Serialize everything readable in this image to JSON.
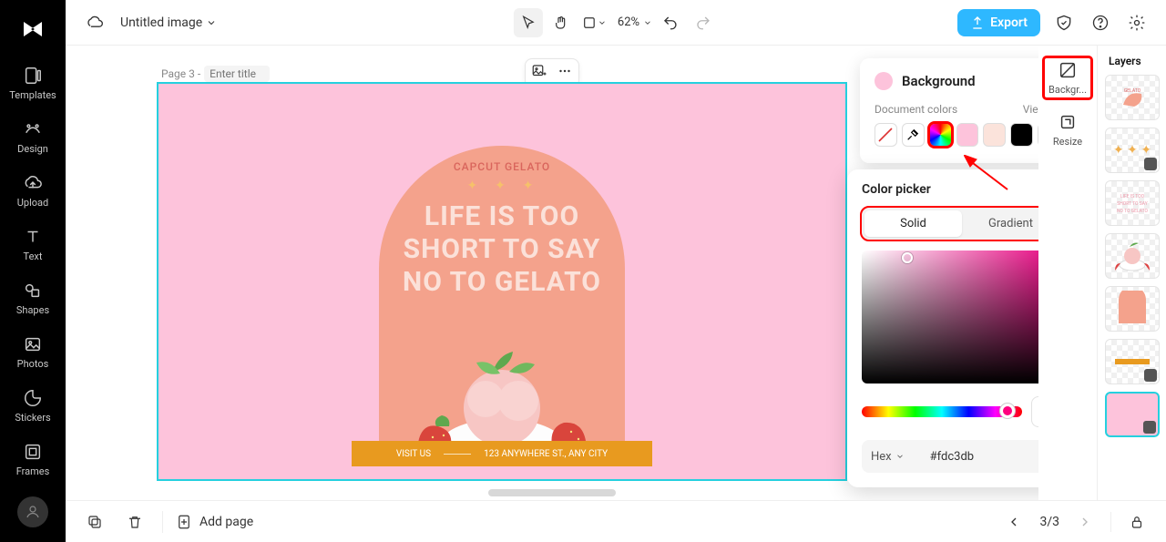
{
  "app": {
    "doc_name": "Untitled image",
    "zoom": "62%"
  },
  "sidebar": {
    "items": [
      {
        "label": "Templates"
      },
      {
        "label": "Design"
      },
      {
        "label": "Upload"
      },
      {
        "label": "Text"
      },
      {
        "label": "Shapes"
      },
      {
        "label": "Photos"
      },
      {
        "label": "Stickers"
      },
      {
        "label": "Frames"
      }
    ]
  },
  "topbar": {
    "export_label": "Export"
  },
  "page": {
    "label": "Page 3 -",
    "title_placeholder": "Enter title"
  },
  "design": {
    "brand": "CAPCUT GELATO",
    "headline_l1": "LIFE IS TOO",
    "headline_l2": "SHORT TO SAY",
    "headline_l3": "NO TO GELATO",
    "visit_label": "VISIT US",
    "address": "123 ANYWHERE ST., ANY CITY"
  },
  "bg_panel": {
    "title": "Background",
    "doc_colors_label": "Document colors",
    "view_all": "View all",
    "colors": [
      "#ffffff",
      "eyedropper",
      "rainbow",
      "#fdc3db",
      "#fbe3db",
      "#000000",
      "#e83f78"
    ]
  },
  "picker": {
    "title": "Color picker",
    "tab_solid": "Solid",
    "tab_gradient": "Gradient",
    "format_label": "Hex",
    "hex": "#fdc3db"
  },
  "right_tools": {
    "background": "Backgr...",
    "resize": "Resize"
  },
  "layers": {
    "title": "Layers"
  },
  "bottom": {
    "add_page": "Add page",
    "page_indicator": "3/3"
  }
}
